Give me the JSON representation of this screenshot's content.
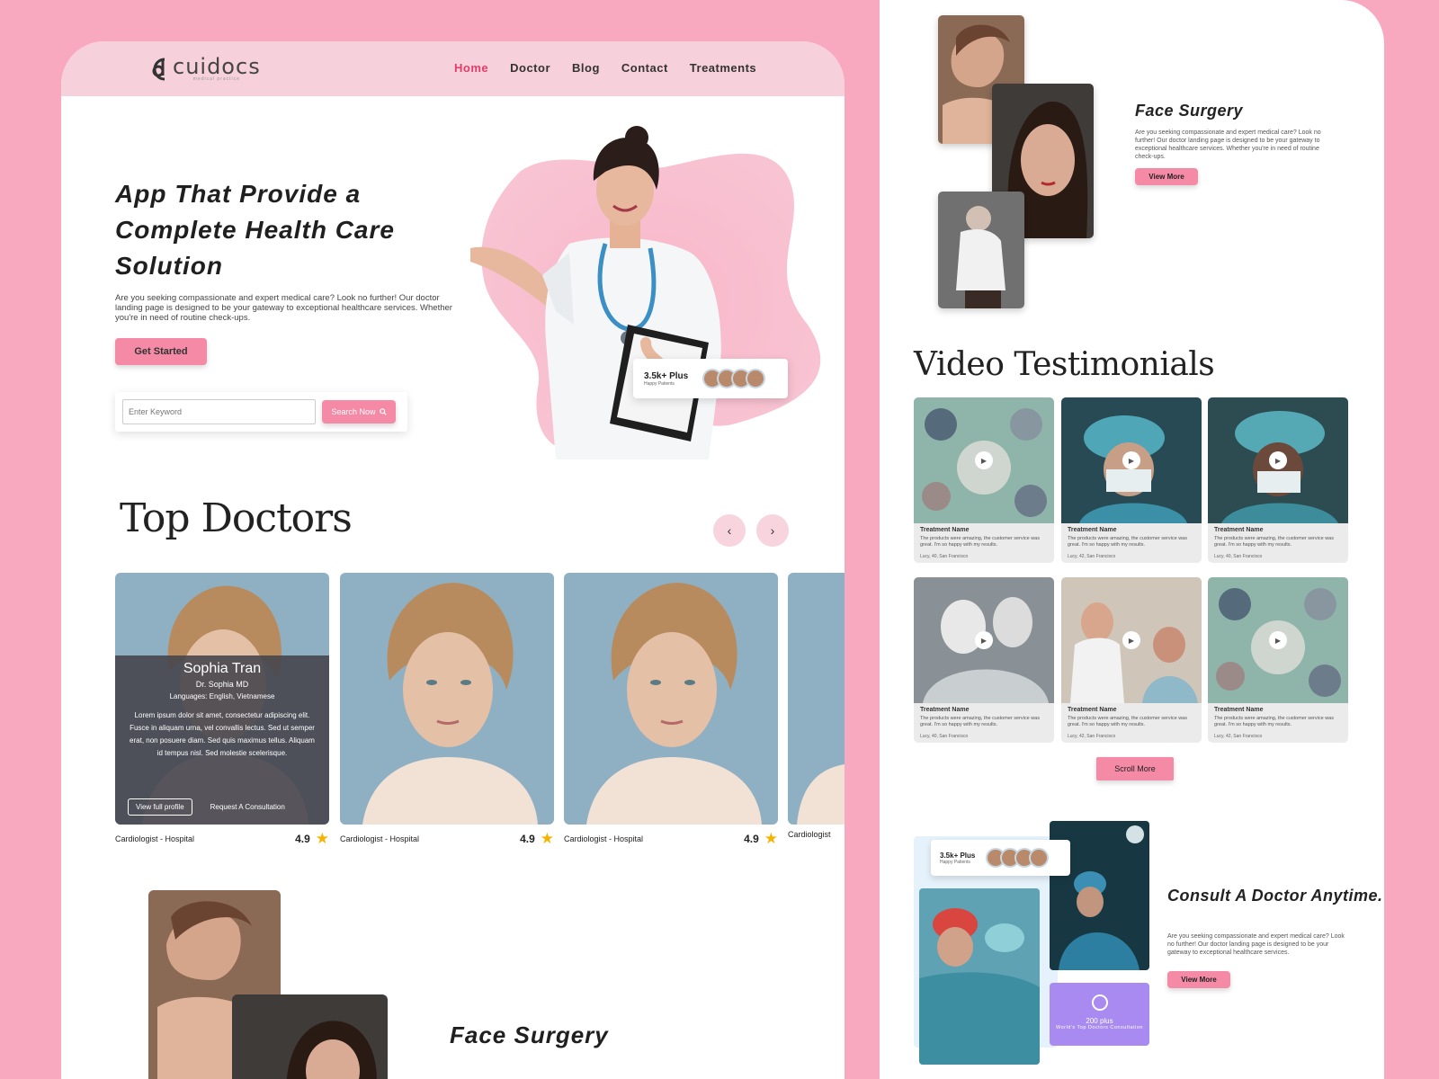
{
  "brand": {
    "name": "cuidocs",
    "tagline": "medical practice"
  },
  "nav": {
    "items": [
      {
        "label": "Home",
        "active": true
      },
      {
        "label": "Doctor"
      },
      {
        "label": "Blog"
      },
      {
        "label": "Contact"
      },
      {
        "label": "Treatments"
      }
    ]
  },
  "hero": {
    "title": "App That Provide a Complete Health Care Solution",
    "description": "Are you seeking compassionate and expert medical care? Look no further! Our doctor landing page is designed to be your gateway to exceptional healthcare services. Whether you're in need of routine check-ups.",
    "cta_label": "Get Started",
    "search_placeholder": "Enter Keyword",
    "search_button": "Search Now",
    "patients_count": "3.5k+ Plus",
    "patients_label": "Happy Patients"
  },
  "top_doctors": {
    "title": "Top Doctors",
    "cards": [
      {
        "name": "Sophia Tran",
        "title": "Dr. Sophia MD",
        "languages": "Languages: English, Vietnamese",
        "bio": "Lorem ipsum dolor sit amet, consectetur adipiscing elit. Fusce in aliquam urna, vel convallis lectus. Sed ut semper erat, non posuere diam. Sed quis maximus tellus. Aliquam id tempus nisl. Sed molestie scelerisque.",
        "view_profile": "View full profile",
        "request": "Request A Consultation",
        "specialty": "Cardiologist - Hospital",
        "rating": "4.9"
      },
      {
        "specialty": "Cardiologist - Hospital",
        "rating": "4.9"
      },
      {
        "specialty": "Cardiologist - Hospital",
        "rating": "4.9"
      },
      {
        "specialty": "Cardiologist"
      }
    ]
  },
  "face_surgery": {
    "title": "Face Surgery",
    "description": "Are you seeking compassionate and expert medical care? Look no further! Our doctor landing page is designed to be your gateway to exceptional healthcare services. Whether you're in need of routine check-ups.",
    "button": "View More"
  },
  "video_testimonials": {
    "title": "Video Testimonials",
    "cards": [
      {
        "name": "Treatment Name",
        "text": "The products were amazing, the customer service was great. I'm so happy with my results.",
        "author": "Lucy, 40, San Francisco"
      },
      {
        "name": "Treatment Name",
        "text": "The products were amazing, the customer service was great. I'm so happy with my results.",
        "author": "Lucy, 42, San Francisco"
      },
      {
        "name": "Treatment Name",
        "text": "The products were amazing, the customer service was great. I'm so happy with my results.",
        "author": "Lucy, 40, San Francisco"
      },
      {
        "name": "Treatment Name",
        "text": "The products were amazing, the customer service was great. I'm so happy with my results.",
        "author": "Lucy, 40, San Francisco"
      },
      {
        "name": "Treatment Name",
        "text": "The products were amazing, the customer service was great. I'm so happy with my results.",
        "author": "Lucy, 42, San Francisco"
      },
      {
        "name": "Treatment Name",
        "text": "The products were amazing, the customer service was great. I'm so happy with my results.",
        "author": "Lucy, 42, San Francisco"
      }
    ],
    "scroll_more": "Scroll More"
  },
  "consult": {
    "title": "Consult A Doctor Anytime.",
    "description": "Are you seeking compassionate and expert medical care? Look no further! Our doctor landing page is designed to be your gateway to exceptional healthcare services.",
    "button": "View More",
    "patients_count": "3.5k+ Plus",
    "patients_label": "Happy Patients",
    "doctors_count": "200 plus",
    "doctors_label": "World's Top Doctors Consultation"
  },
  "colors": {
    "page_bg": "#f9a9bf",
    "accent": "#f48aa6",
    "nav_active": "#e43d6a",
    "purple": "#a88af0"
  }
}
